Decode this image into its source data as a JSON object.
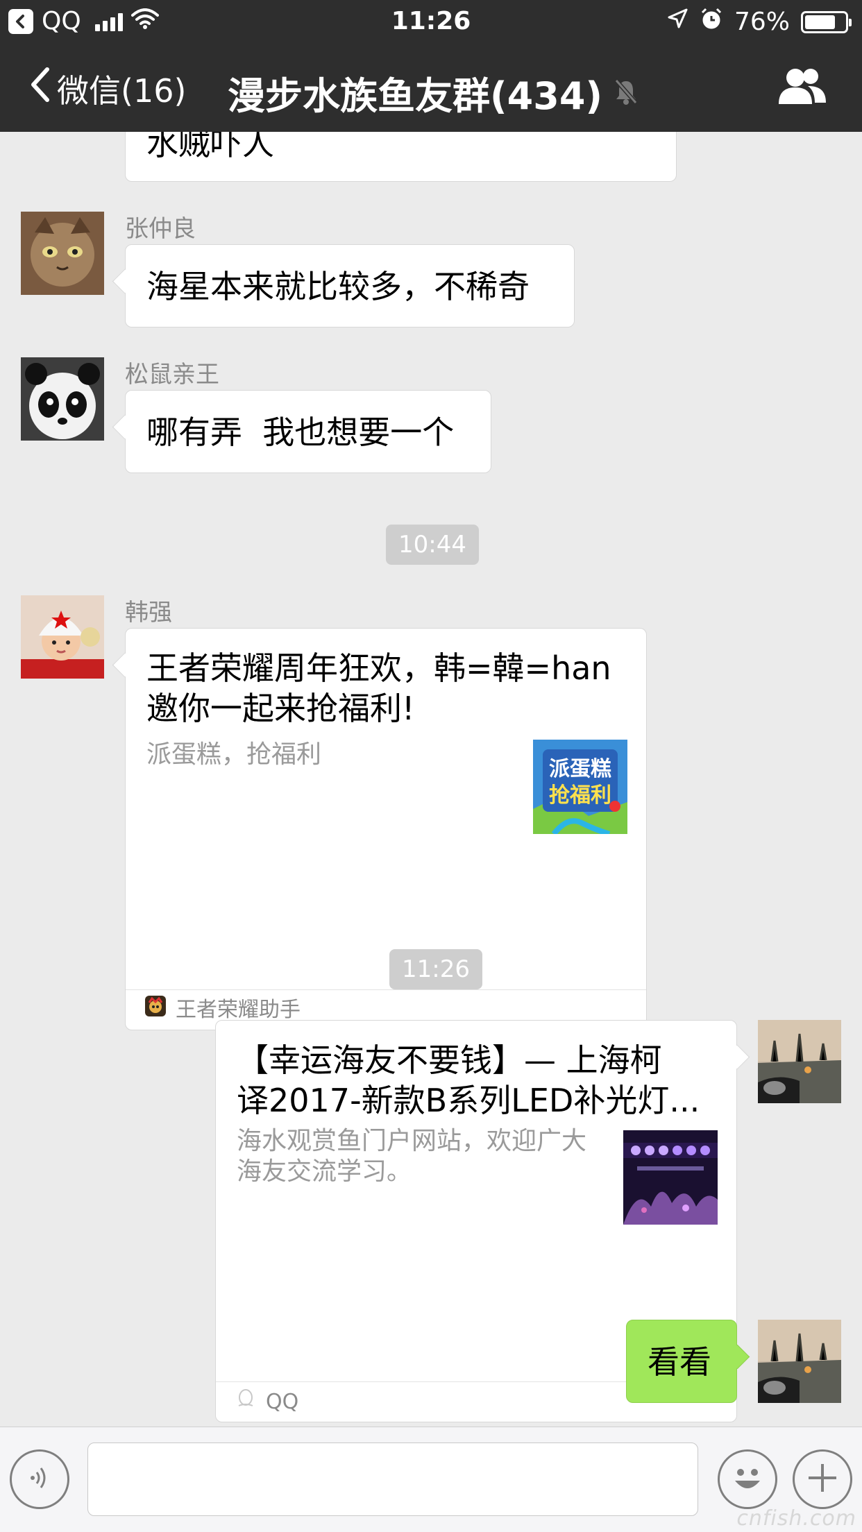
{
  "status_bar": {
    "carrier": "QQ",
    "time": "11:26",
    "battery": "76%",
    "battery_level": 0.76
  },
  "nav": {
    "back_label": "微信(16)",
    "title": "漫步水族鱼友群(434)"
  },
  "messages": {
    "cut_off_text": "水贼吓人",
    "m1": {
      "sender": "张仲良",
      "text": "海星本来就比较多，不稀奇"
    },
    "m2": {
      "sender": "松鼠亲王",
      "text": "哪有弄  我也想要一个"
    },
    "time1": "10:44",
    "m3": {
      "sender": "韩强",
      "title_line1": "王者荣耀周年狂欢，韩=韓=han",
      "title_line2": "邀你一起来抢福利!",
      "desc": "派蛋糕，抢福利",
      "thumb_text_1": "派蛋糕",
      "thumb_text_2": "抢福利",
      "source": "王者荣耀助手"
    },
    "time2": "11:26",
    "m4": {
      "title_line1": "【幸运海友不要钱】— 上海柯",
      "title_line2": "译2017-新款B系列LED补光灯...",
      "desc_line1": "海水观赏鱼门户网站，欢迎广大",
      "desc_line2": "海友交流学习。",
      "source": "QQ"
    },
    "m5": {
      "text": "看看"
    }
  },
  "watermark": "cnfish.com",
  "colors": {
    "bar_bg": "#2e2e2e",
    "chat_bg": "#ebebeb",
    "my_bubble": "#a0e75a",
    "timestamp_chip": "#cecece"
  },
  "icons": [
    "back-chevron-icon",
    "signal-icon",
    "wifi-icon",
    "location-icon",
    "alarm-icon",
    "battery-icon",
    "mute-icon",
    "group-members-icon",
    "voice-icon",
    "emoji-icon",
    "plus-icon",
    "qq-icon",
    "game-app-icon"
  ]
}
